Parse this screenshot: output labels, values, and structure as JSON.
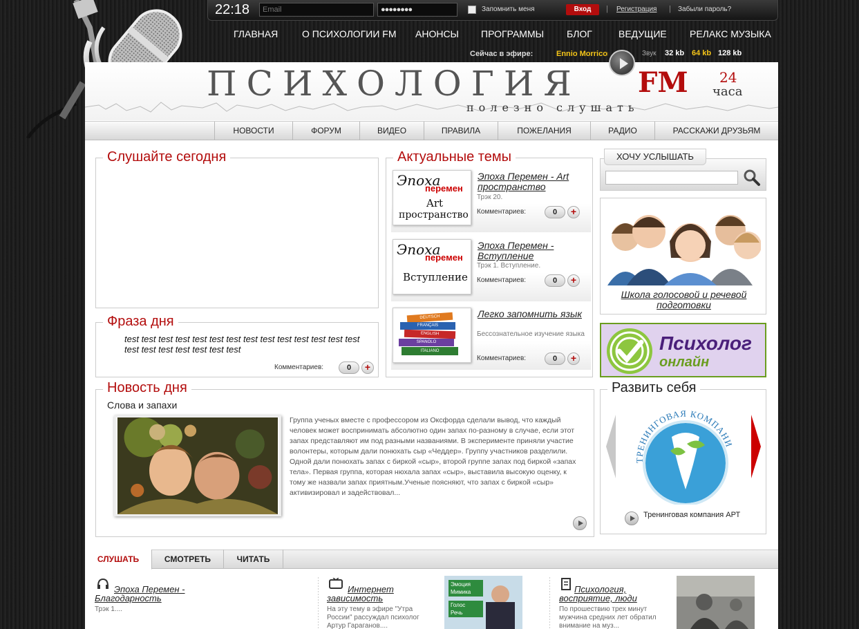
{
  "topbar": {
    "time": "22:18",
    "email_placeholder": "Email",
    "password_value": "●●●●●●●●",
    "remember_label": "Запомнить меня",
    "login_label": "Вход",
    "separator": "|",
    "register_label": "Регистрация",
    "forgot_label": "Забыли пароль?"
  },
  "main_nav": [
    "ГЛАВНАЯ",
    "О ПСИХОЛОГИИ FM",
    "АНОНСЫ",
    "ПРОГРАММЫ",
    "БЛОГ",
    "ВЕДУЩИЕ",
    "РЕЛАКС МУЗЫКА"
  ],
  "onair": {
    "label": "Сейчас в эфире:",
    "track": "Ennio Morricone",
    "sound_label": "Звук",
    "bitrates": [
      "32 kb",
      "64 kb",
      "128 kb"
    ],
    "bitrate_colors": [
      "#ffffff",
      "#f5c518",
      "#ffffff"
    ]
  },
  "logo": {
    "name": "ПСИХОЛОГИЯ",
    "fm": "FM",
    "slogan": "полезно слушать",
    "hours": "24",
    "hours_label": "часа"
  },
  "sub_nav": [
    "НОВОСТИ",
    "ФОРУМ",
    "ВИДЕО",
    "ПРАВИЛА",
    "ПОЖЕЛАНИЯ",
    "РАДИО",
    "РАССКАЖИ ДРУЗЬЯМ"
  ],
  "listen_today": {
    "title": "Слушайте сегодня"
  },
  "phrase": {
    "title": "Фраза дня",
    "text": "test test test test test test test test test test test test test test test test test test test test test",
    "comments_label": "Комментариев:",
    "count": "0",
    "plus": "+"
  },
  "topics": {
    "title": "Актуальные темы",
    "items": [
      {
        "img_line1": "Эпоха",
        "img_line2": "перемен",
        "img_line3": "Art",
        "img_line4": "пространство",
        "title": "Эпоха Перемен - Art пространство",
        "sub": "Трэк 20.",
        "comments_label": "Комментариев:",
        "count": "0"
      },
      {
        "img_line1": "Эпоха",
        "img_line2": "перемен",
        "img_line3": "Вступление",
        "img_line4": "",
        "title": "Эпоха Перемен - Вступление",
        "sub": "Трэк 1. Вступление.",
        "comments_label": "Комментариев:",
        "count": "0"
      },
      {
        "books": [
          "DEUTSCH",
          "FRANÇAIS",
          "ENGLISH",
          "SPANOLO",
          "ITALIANO"
        ],
        "title": "Легко запомнить язык",
        "sub": "Бессознательное изучение языка",
        "comments_label": "Комментариев:",
        "count": "0"
      }
    ]
  },
  "want_to_hear": {
    "title": "ХОЧУ УСЛЫШАТЬ",
    "search_value": ""
  },
  "school": {
    "caption": "Школа голосовой и речевой подготовки"
  },
  "psychologist": {
    "line1": "Психолог",
    "line2": "онлайн"
  },
  "news": {
    "title": "Новость дня",
    "subtitle": "Слова и запахи",
    "body": "Группа ученых вместе с профессором из Оксфорда сделали вывод, что каждый человек может воспринимать абсолютно один запах по-разному в случае, если этот запах представляют им под разными названиями. В эксперименте приняли участие волонтеры, которым дали понюхать сыр «Чеддер». Группу участников разделили. Одной дали понюхать запах с биркой «сыр», второй группе запах под биркой «запах тела». Первая группа, которая нюхала запах «сыр», выставила высокую оценку, к тому же назвали запах приятным.Ученые поясняют, что запах с биркой «сыр» активизировал и задействовал..."
  },
  "develop": {
    "title": "Развить себя",
    "logo_text": "ТРЕНИНГОВАЯ КОМПАНИЯ АРТ",
    "caption": "Тренинговая компания АРТ"
  },
  "bottom_tabs": [
    "СЛУШАТЬ",
    "СМОТРЕТЬ",
    "ЧИТАТЬ"
  ],
  "bottom_items": [
    {
      "title": "Эпоха Перемен - Благодарность",
      "sub": "Трэк 1...."
    },
    {
      "title": "Интернет зависимость",
      "sub": "На эту тему в эфире \"Утра России\" рассуждал психолог Артур Гараганов....",
      "thumb_labels": [
        "Эмоция",
        "Мимика",
        "Голос",
        "Речь"
      ]
    },
    {
      "title": "Психология, восприятие, люди",
      "sub": "По прошествию трех минут мужчина средних лет обратил внимание на муз..."
    }
  ],
  "colors": {
    "accent": "#b30d0d",
    "gold": "#f5c518",
    "green": "#6a9d1f"
  }
}
